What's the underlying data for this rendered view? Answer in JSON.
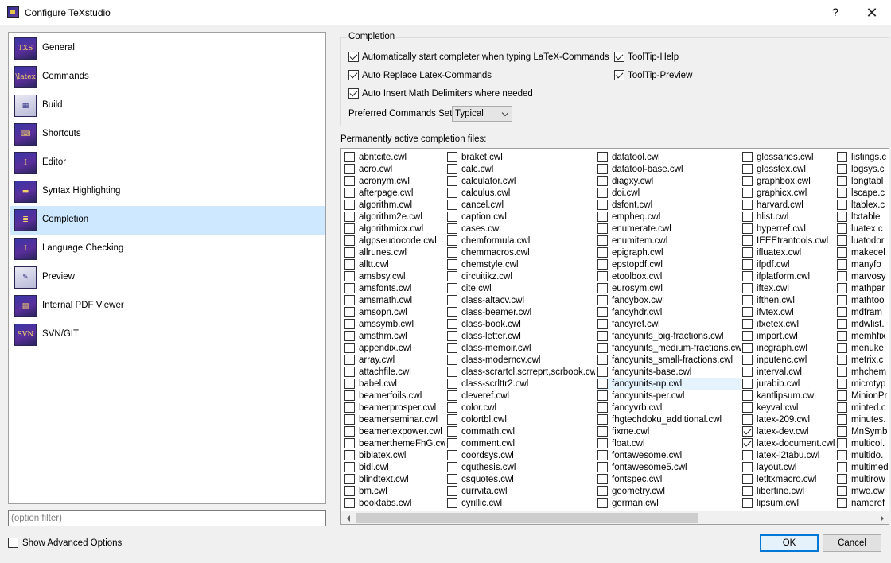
{
  "window": {
    "title": "Configure TeXstudio",
    "help_symbol": "?",
    "close_symbol": "✕"
  },
  "sidebar": {
    "items": [
      {
        "label": "General",
        "icon": "txs-icon",
        "glyph": "TXS"
      },
      {
        "label": "Commands",
        "icon": "latex-icon",
        "glyph": "\\latex"
      },
      {
        "label": "Build",
        "icon": "build-icon",
        "glyph": "▦"
      },
      {
        "label": "Shortcuts",
        "icon": "keyboard-icon",
        "glyph": "⌨"
      },
      {
        "label": "Editor",
        "icon": "text-cursor-icon",
        "glyph": "I"
      },
      {
        "label": "Syntax Highlighting",
        "icon": "highlight-icon",
        "glyph": "▬"
      },
      {
        "label": "Completion",
        "icon": "completion-list-icon",
        "glyph": "≣"
      },
      {
        "label": "Language Checking",
        "icon": "spellcheck-icon",
        "glyph": "I"
      },
      {
        "label": "Preview",
        "icon": "preview-icon",
        "glyph": "✎"
      },
      {
        "label": "Internal PDF Viewer",
        "icon": "pdf-viewer-icon",
        "glyph": "▤"
      },
      {
        "label": "SVN/GIT",
        "icon": "svn-icon",
        "glyph": "SVN"
      }
    ],
    "selected_index": 6
  },
  "filter": {
    "placeholder": "(option filter)"
  },
  "advanced": {
    "label": "Show Advanced Options",
    "checked": false
  },
  "completion": {
    "group_title": "Completion",
    "options": [
      {
        "label": "Automatically start completer when typing LaTeX-Commands",
        "checked": true
      },
      {
        "label": "Auto Replace Latex-Commands",
        "checked": true
      },
      {
        "label": "Auto Insert Math Delimiters where needed",
        "checked": true
      },
      {
        "label": "ToolTip-Help",
        "checked": true
      },
      {
        "label": "ToolTip-Preview",
        "checked": true
      }
    ],
    "preferred_label": "Preferred Commands Set:",
    "preferred_value": "Typical"
  },
  "files": {
    "label": "Permanently active completion files:",
    "highlighted": "fancyunits-np.cwl",
    "columns": [
      {
        "items": [
          {
            "name": "abntcite.cwl"
          },
          {
            "name": "acro.cwl"
          },
          {
            "name": "acronym.cwl"
          },
          {
            "name": "afterpage.cwl"
          },
          {
            "name": "algorithm.cwl"
          },
          {
            "name": "algorithm2e.cwl"
          },
          {
            "name": "algorithmicx.cwl"
          },
          {
            "name": "algpseudocode.cwl"
          },
          {
            "name": "allrunes.cwl"
          },
          {
            "name": "alltt.cwl"
          },
          {
            "name": "amsbsy.cwl"
          },
          {
            "name": "amsfonts.cwl"
          },
          {
            "name": "amsmath.cwl"
          },
          {
            "name": "amsopn.cwl"
          },
          {
            "name": "amssymb.cwl"
          },
          {
            "name": "amsthm.cwl"
          },
          {
            "name": "appendix.cwl"
          },
          {
            "name": "array.cwl"
          },
          {
            "name": "attachfile.cwl"
          },
          {
            "name": "babel.cwl"
          },
          {
            "name": "beamerfoils.cwl"
          },
          {
            "name": "beamerprosper.cwl"
          },
          {
            "name": "beamerseminar.cwl"
          },
          {
            "name": "beamertexpower.cwl"
          },
          {
            "name": "beamerthemeFhG.cwl"
          },
          {
            "name": "biblatex.cwl"
          },
          {
            "name": "bidi.cwl"
          },
          {
            "name": "blindtext.cwl"
          },
          {
            "name": "bm.cwl"
          },
          {
            "name": "booktabs.cwl"
          }
        ]
      },
      {
        "items": [
          {
            "name": "braket.cwl"
          },
          {
            "name": "calc.cwl"
          },
          {
            "name": "calculator.cwl"
          },
          {
            "name": "calculus.cwl"
          },
          {
            "name": "cancel.cwl"
          },
          {
            "name": "caption.cwl"
          },
          {
            "name": "cases.cwl"
          },
          {
            "name": "chemformula.cwl"
          },
          {
            "name": "chemmacros.cwl"
          },
          {
            "name": "chemstyle.cwl"
          },
          {
            "name": "circuitikz.cwl"
          },
          {
            "name": "cite.cwl"
          },
          {
            "name": "class-altacv.cwl"
          },
          {
            "name": "class-beamer.cwl"
          },
          {
            "name": "class-book.cwl"
          },
          {
            "name": "class-letter.cwl"
          },
          {
            "name": "class-memoir.cwl"
          },
          {
            "name": "class-moderncv.cwl"
          },
          {
            "name": "class-scrartcl,scrreprt,scrbook.cwl"
          },
          {
            "name": "class-scrlttr2.cwl"
          },
          {
            "name": "cleveref.cwl"
          },
          {
            "name": "color.cwl"
          },
          {
            "name": "colortbl.cwl"
          },
          {
            "name": "commath.cwl"
          },
          {
            "name": "comment.cwl"
          },
          {
            "name": "coordsys.cwl"
          },
          {
            "name": "cquthesis.cwl"
          },
          {
            "name": "csquotes.cwl"
          },
          {
            "name": "currvita.cwl"
          },
          {
            "name": "cyrillic.cwl"
          }
        ]
      },
      {
        "items": [
          {
            "name": "datatool.cwl"
          },
          {
            "name": "datatool-base.cwl"
          },
          {
            "name": "diagxy.cwl"
          },
          {
            "name": "doi.cwl"
          },
          {
            "name": "dsfont.cwl"
          },
          {
            "name": "empheq.cwl"
          },
          {
            "name": "enumerate.cwl"
          },
          {
            "name": "enumitem.cwl"
          },
          {
            "name": "epigraph.cwl"
          },
          {
            "name": "epstopdf.cwl"
          },
          {
            "name": "etoolbox.cwl"
          },
          {
            "name": "eurosym.cwl"
          },
          {
            "name": "fancybox.cwl"
          },
          {
            "name": "fancyhdr.cwl"
          },
          {
            "name": "fancyref.cwl"
          },
          {
            "name": "fancyunits_big-fractions.cwl"
          },
          {
            "name": "fancyunits_medium-fractions.cwl"
          },
          {
            "name": "fancyunits_small-fractions.cwl"
          },
          {
            "name": "fancyunits-base.cwl"
          },
          {
            "name": "fancyunits-np.cwl"
          },
          {
            "name": "fancyunits-per.cwl"
          },
          {
            "name": "fancyvrb.cwl"
          },
          {
            "name": "fhgtechdoku_additional.cwl"
          },
          {
            "name": "fixme.cwl"
          },
          {
            "name": "float.cwl"
          },
          {
            "name": "fontawesome.cwl"
          },
          {
            "name": "fontawesome5.cwl"
          },
          {
            "name": "fontspec.cwl"
          },
          {
            "name": "geometry.cwl"
          },
          {
            "name": "german.cwl"
          }
        ]
      },
      {
        "items": [
          {
            "name": "glossaries.cwl"
          },
          {
            "name": "glosstex.cwl"
          },
          {
            "name": "graphbox.cwl"
          },
          {
            "name": "graphicx.cwl"
          },
          {
            "name": "harvard.cwl"
          },
          {
            "name": "hlist.cwl"
          },
          {
            "name": "hyperref.cwl"
          },
          {
            "name": "IEEEtrantools.cwl"
          },
          {
            "name": "ifluatex.cwl"
          },
          {
            "name": "ifpdf.cwl"
          },
          {
            "name": "ifplatform.cwl"
          },
          {
            "name": "iftex.cwl"
          },
          {
            "name": "ifthen.cwl"
          },
          {
            "name": "ifvtex.cwl"
          },
          {
            "name": "ifxetex.cwl"
          },
          {
            "name": "import.cwl"
          },
          {
            "name": "incgraph.cwl"
          },
          {
            "name": "inputenc.cwl"
          },
          {
            "name": "interval.cwl"
          },
          {
            "name": "jurabib.cwl"
          },
          {
            "name": "kantlipsum.cwl"
          },
          {
            "name": "keyval.cwl"
          },
          {
            "name": "latex-209.cwl"
          },
          {
            "name": "latex-dev.cwl",
            "checked": true
          },
          {
            "name": "latex-document.cwl",
            "checked": true
          },
          {
            "name": "latex-l2tabu.cwl"
          },
          {
            "name": "layout.cwl"
          },
          {
            "name": "letltxmacro.cwl"
          },
          {
            "name": "libertine.cwl"
          },
          {
            "name": "lipsum.cwl"
          }
        ]
      },
      {
        "items": [
          {
            "name": "listings.c"
          },
          {
            "name": "logsys.c"
          },
          {
            "name": "longtabl"
          },
          {
            "name": "lscape.c"
          },
          {
            "name": "ltablex.c"
          },
          {
            "name": "ltxtable"
          },
          {
            "name": "luatex.c"
          },
          {
            "name": "luatodor"
          },
          {
            "name": "makecel"
          },
          {
            "name": "manyfo"
          },
          {
            "name": "marvosy"
          },
          {
            "name": "mathpar"
          },
          {
            "name": "mathtoo"
          },
          {
            "name": "mdfram"
          },
          {
            "name": "mdwlist."
          },
          {
            "name": "memhfix"
          },
          {
            "name": "menuke"
          },
          {
            "name": "metrix.c"
          },
          {
            "name": "mhchem"
          },
          {
            "name": "microtyp"
          },
          {
            "name": "MinionPr"
          },
          {
            "name": "minted.c"
          },
          {
            "name": "minutes."
          },
          {
            "name": "MnSymb"
          },
          {
            "name": "multicol."
          },
          {
            "name": "multido."
          },
          {
            "name": "multimed"
          },
          {
            "name": "multirow"
          },
          {
            "name": "mwe.cw"
          },
          {
            "name": "nameref"
          }
        ]
      }
    ]
  },
  "buttons": {
    "ok": "OK",
    "cancel": "Cancel"
  }
}
